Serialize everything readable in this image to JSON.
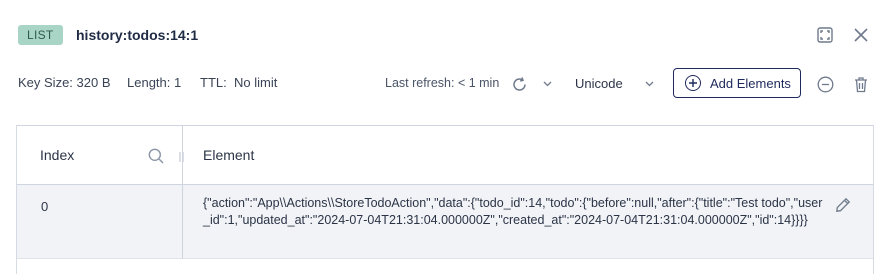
{
  "header": {
    "type_badge": "LIST",
    "key_name": "history:todos:14:1"
  },
  "info": {
    "key_size_label": "Key Size:",
    "key_size_value": "320 B",
    "length_label": "Length:",
    "length_value": "1",
    "ttl_label": "TTL:",
    "ttl_value": "No limit",
    "last_refresh": "Last refresh: < 1 min",
    "encoding": "Unicode",
    "add_elements_label": "Add Elements"
  },
  "table": {
    "columns": [
      "Index",
      "Element"
    ],
    "rows": [
      {
        "index": "0",
        "element": "{\"action\":\"App\\\\Actions\\\\StoreTodoAction\",\"data\":{\"todo_id\":14,\"todo\":{\"before\":null,\"after\":{\"title\":\"Test todo\",\"user_id\":1,\"updated_at\":\"2024-07-04T21:31:04.000000Z\",\"created_at\":\"2024-07-04T21:31:04.000000Z\",\"id\":14}}}}"
      }
    ]
  },
  "icons": {
    "fullscreen": "fullscreen-icon",
    "close": "close-icon",
    "refresh": "refresh-icon",
    "chevron": "chevron-down-icon",
    "plus": "plus-circle-icon",
    "remove": "minus-circle-icon",
    "delete": "trash-icon",
    "search": "search-icon",
    "edit": "pencil-icon"
  },
  "colors": {
    "badge_bg": "#a8d5c5",
    "primary": "#1f2a5c",
    "row_bg": "#f1f3f6"
  }
}
